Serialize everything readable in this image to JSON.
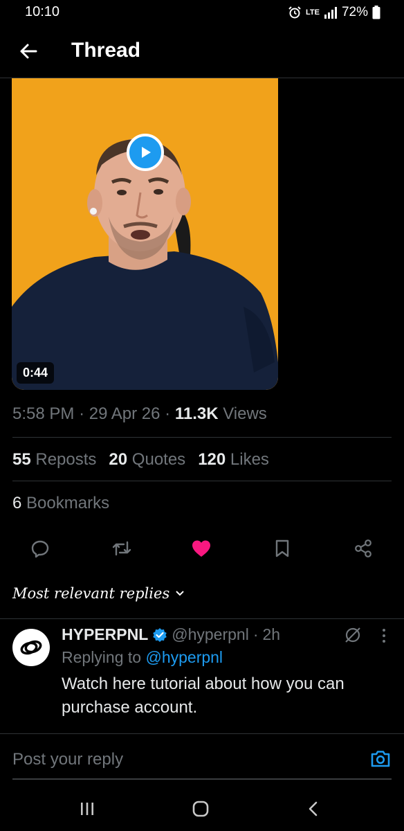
{
  "status_bar": {
    "time": "10:10",
    "network": "LTE",
    "battery": "72%",
    "icons": [
      "alarm-icon",
      "signal-icon",
      "battery-icon"
    ]
  },
  "header": {
    "title": "Thread",
    "back_icon": "arrow-left-icon"
  },
  "media": {
    "duration": "0:44",
    "play_icon": "play-icon",
    "background_color": "#f1a21b"
  },
  "post": {
    "time": "5:58 PM",
    "date": "29 Apr 26",
    "views_count": "11.3K",
    "views_label": "Views",
    "reposts_count": "55",
    "reposts_label": "Reposts",
    "quotes_count": "20",
    "quotes_label": "Quotes",
    "likes_count": "120",
    "likes_label": "Likes",
    "bookmarks_count": "6",
    "bookmarks_label": "Bookmarks"
  },
  "actions": [
    "reply-icon",
    "repost-icon",
    "like-icon",
    "bookmark-icon",
    "share-icon"
  ],
  "sort": {
    "label": "Most relevant replies"
  },
  "reply": {
    "name": "HYPERPNL",
    "handle": "@hyperpnl",
    "age": "2h",
    "replying_prefix": "Replying to",
    "replying_handle": "@hyperpnl",
    "text": "Watch here tutorial about how you can purchase account."
  },
  "composer": {
    "placeholder": "Post your reply"
  },
  "colors": {
    "accent": "#1d9bf0",
    "like": "#f91880",
    "muted": "#71767b"
  }
}
